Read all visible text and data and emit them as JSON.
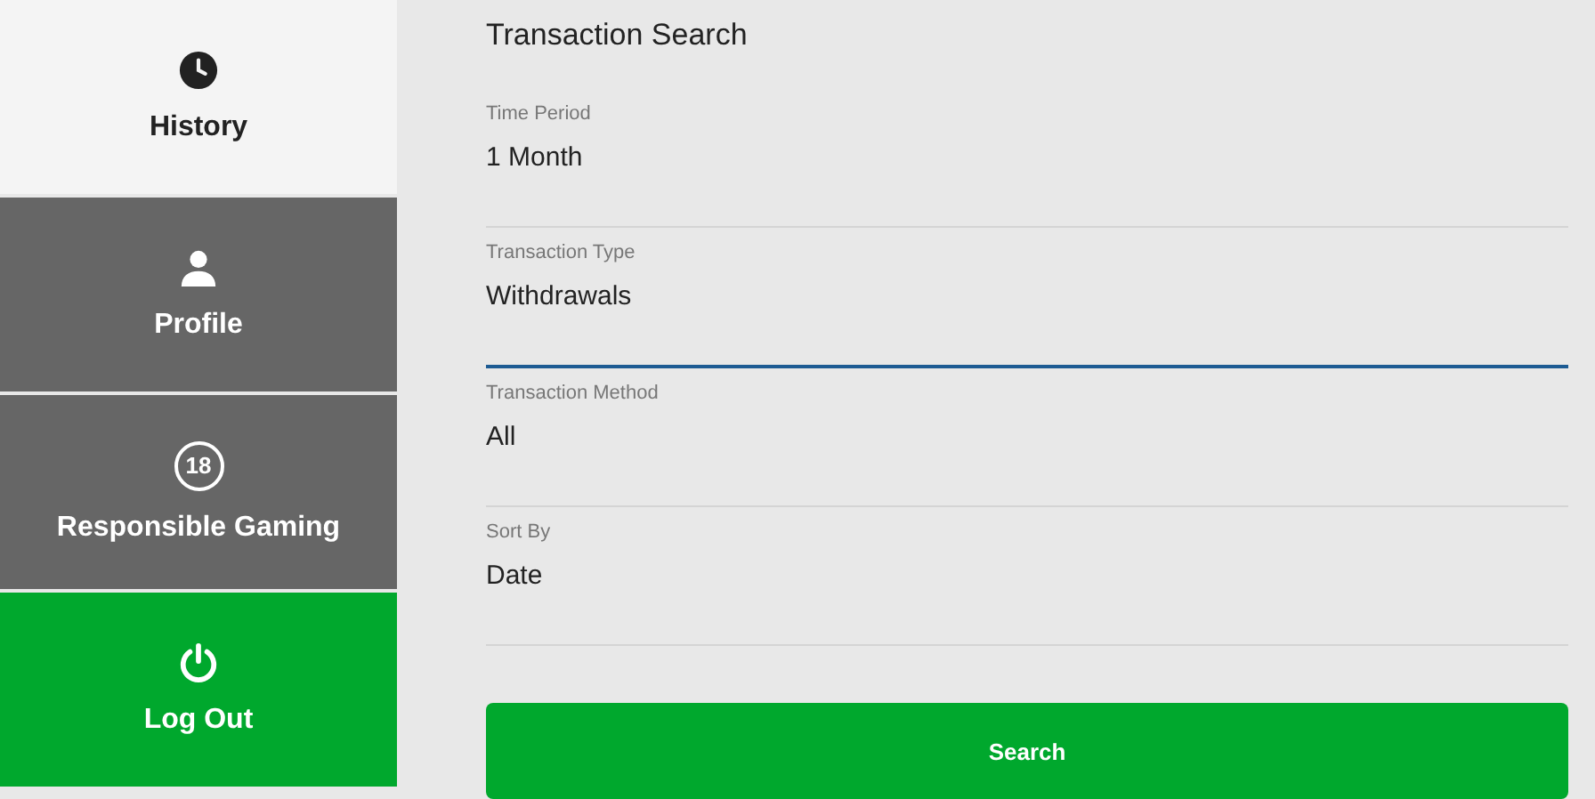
{
  "sidebar": {
    "items": [
      {
        "label": "History",
        "kind": "history",
        "selected": true
      },
      {
        "label": "Profile",
        "kind": "profile",
        "selected": false
      },
      {
        "label": "Responsible Gaming",
        "kind": "age",
        "icon_text": "18",
        "selected": false
      },
      {
        "label": "Log Out",
        "kind": "logout",
        "selected": false
      }
    ]
  },
  "form": {
    "title": "Transaction Search",
    "fields": [
      {
        "label": "Time Period",
        "value": "1 Month",
        "focused": false
      },
      {
        "label": "Transaction Type",
        "value": "Withdrawals",
        "focused": true
      },
      {
        "label": "Transaction Method",
        "value": "All",
        "focused": false
      },
      {
        "label": "Sort By",
        "value": "Date",
        "focused": false
      }
    ],
    "button": "Search"
  }
}
